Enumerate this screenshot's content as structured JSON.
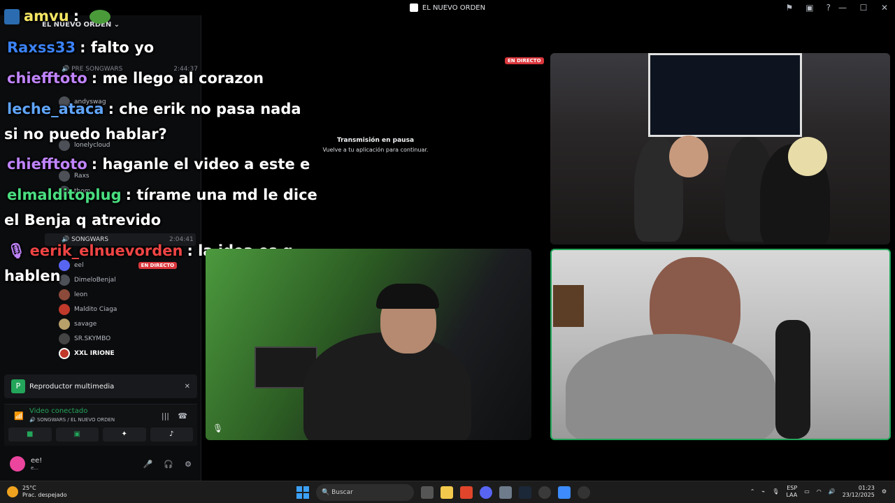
{
  "window": {
    "title": "EL NUEVO ORDEN",
    "controls": [
      "—",
      "☐",
      "✕"
    ]
  },
  "sidebar": {
    "server_name": "EL NUEVO ORDEN",
    "channels": [
      {
        "name": "PRE SONGWARS",
        "time": "2:44:37"
      },
      {
        "name": "SONGWARS",
        "time": "2:04:41"
      }
    ],
    "pre_members": [
      "andyswag",
      "lonelycloud",
      "Raxs",
      "thom"
    ],
    "members": [
      "eel",
      "DimeloBenjal",
      "leon",
      "Maldito Ciaga",
      "savage",
      "SR.SKYMBO",
      "XXL IRIONE"
    ],
    "live_label": "EN DIRECTO"
  },
  "chat": [
    {
      "user": "amvu",
      "text": "",
      "color": "#f5e663"
    },
    {
      "user": "Raxss33",
      "text": ": falto yo",
      "color": "#3b82f6"
    },
    {
      "user": "chiefftoto",
      "text": ": me llego al corazon",
      "color": "#c084fc"
    },
    {
      "user": "leche_ataca",
      "text": ": che erik no pasa nada",
      "color": "#60a5fa"
    },
    {
      "user": "",
      "text": "si no puedo hablar?",
      "color": "#ffffff"
    },
    {
      "user": "chiefftoto",
      "text": ": haganle el video a este e",
      "color": "#c084fc"
    },
    {
      "user": "elmalditoplug",
      "text": ": tírame una md le dice",
      "color": "#4ade80"
    },
    {
      "user": "",
      "text": "el Benja q atrevido",
      "color": "#ffffff"
    },
    {
      "user": "eerik_elnuevorden",
      "text": ": la idea es q",
      "color": "#ef4444"
    },
    {
      "user": "",
      "text": "hablen",
      "color": "#ffffff"
    }
  ],
  "stream": {
    "live_badge": "EN DIRECTO",
    "paused_title": "Transmisión en pausa",
    "paused_sub": "Vuelve a tu aplicación para continuar."
  },
  "player": {
    "label": "Reproductor multimedia"
  },
  "voice": {
    "status": "Video conectado",
    "location": "SONGWARS / EL NUEVO ORDEN"
  },
  "user": {
    "name": "ee!",
    "status": "e..."
  },
  "taskbar": {
    "temperature": "25°C",
    "weather": "Prac. despejado",
    "search_placeholder": "Buscar",
    "lang_top": "ESP",
    "lang_bottom": "LAA",
    "time": "01:23",
    "date": "23/12/2025"
  },
  "colors": {
    "live_red": "#da373c",
    "connected_green": "#23a55a",
    "speaking_border": "#23a55a"
  }
}
